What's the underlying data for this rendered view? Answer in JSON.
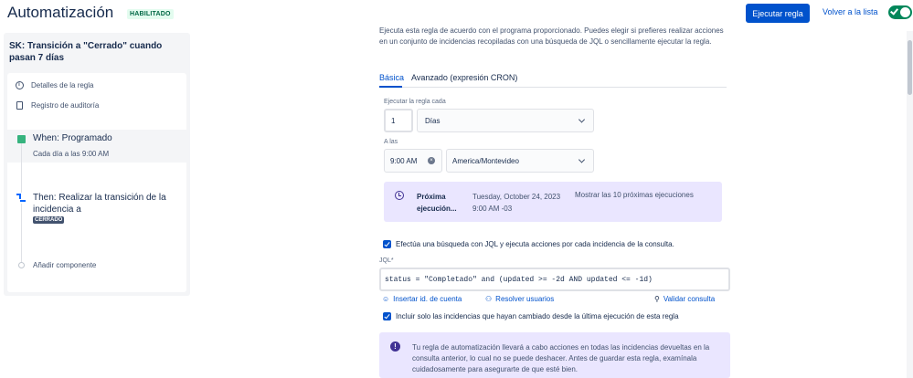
{
  "header": {
    "title": "Automatización",
    "badge": "HABILITADO",
    "run_rule": "Ejecutar regla",
    "back_to_list": "Volver a la lista",
    "enabled": true
  },
  "sidebar": {
    "rule_name": "SK: Transición a \"Cerrado\" cuando pasan 7 días",
    "items": [
      {
        "label": "Detalles de la regla",
        "icon": "info-icon"
      },
      {
        "label": "Registro de auditoría",
        "icon": "document-icon"
      }
    ],
    "trigger": {
      "title": "When: Programado",
      "subtitle": "Cada día a las 9:00 AM",
      "icon": "calendar-icon"
    },
    "action": {
      "title": "Then: Realizar la transición de la incidencia a",
      "status": "CERRADO",
      "icon": "transition-icon"
    },
    "add_component": "Añadir componente"
  },
  "main": {
    "description": "Ejecuta esta regla de acuerdo con el programa proporcionado. Puedes elegir si prefieres realizar acciones en un conjunto de incidencias recopiladas con una búsqueda de JQL o sencillamente ejecutar la regla.",
    "tabs": [
      {
        "label": "Básica",
        "active": true
      },
      {
        "label": "Avanzado (expresión CRON)",
        "active": false
      }
    ],
    "run_every_label": "Ejecutar la regla cada",
    "run_every_value": "1",
    "run_every_unit": "Días",
    "at_label": "A las",
    "time_value": "9:00 AM",
    "timezone": "America/Montevideo",
    "next_run": {
      "label": "Próxima ejecución...",
      "date_line1": "Tuesday, October 24, 2023",
      "date_line2": "9:00 AM -03",
      "show_next": "Mostrar las 10 próximas ejecuciones"
    },
    "jql_checkbox": "Efectúa una búsqueda con JQL y ejecuta acciones por cada incidencia de la consulta.",
    "jql_label": "JQL*",
    "jql_value": "status = \"Completado\" and (updated >= -2d AND updated <= -1d)",
    "actions": {
      "insert_id": "Insertar id. de cuenta",
      "resolve_users": "Resolver usuarios",
      "validate": "Validar consulta"
    },
    "changed_checkbox": "Incluir solo las incidencias que hayan cambiado desde la última ejecución de esta regla",
    "warning": "Tu regla de automatización llevará a cabo acciones en todas las incidencias devueltas en la consulta anterior, lo cual no se puede deshacer. Antes de guardar esta regla, examínala cuidadosamente para asegurarte de que esté bien."
  },
  "colors": {
    "primary": "#0052cc",
    "success": "#00875a",
    "info_bg": "#eae6ff",
    "neutral_bg": "#f4f5f7"
  }
}
